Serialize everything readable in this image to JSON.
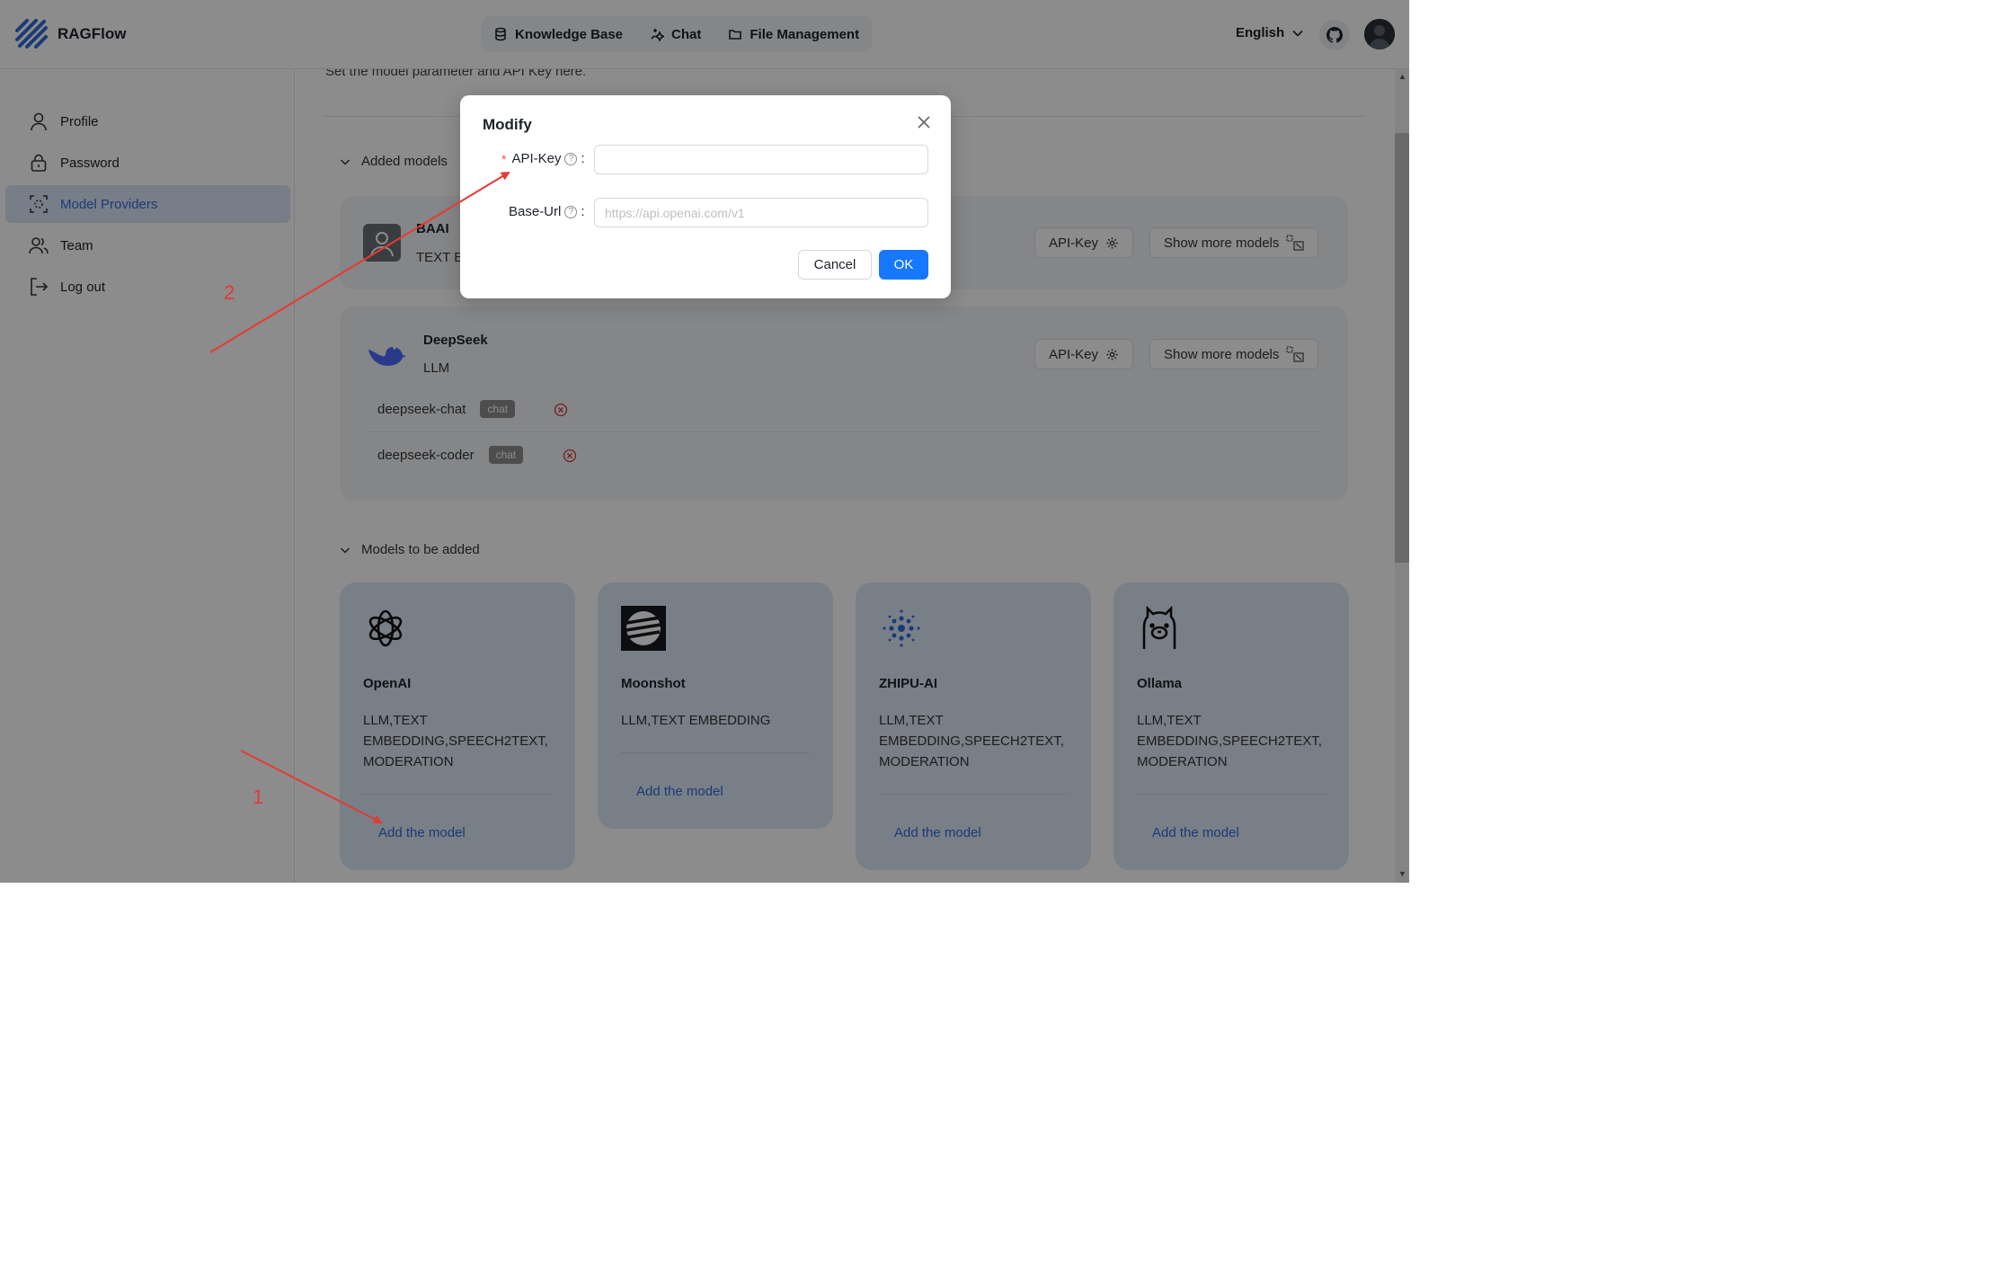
{
  "header": {
    "brand": "RAGFlow",
    "nav": [
      {
        "label": "Knowledge Base",
        "icon": "database-icon"
      },
      {
        "label": "Chat",
        "icon": "chat-sparkle-icon"
      },
      {
        "label": "File Management",
        "icon": "folder-icon"
      }
    ],
    "language": "English"
  },
  "sidebar": {
    "items": [
      {
        "label": "Profile",
        "icon": "user-icon"
      },
      {
        "label": "Password",
        "icon": "lock-icon"
      },
      {
        "label": "Model Providers",
        "icon": "model-providers-icon",
        "active": true
      },
      {
        "label": "Team",
        "icon": "team-icon"
      },
      {
        "label": "Log out",
        "icon": "logout-icon"
      }
    ]
  },
  "main": {
    "subtitle": "Set the model parameter and API Key here.",
    "added_title": "Added models",
    "added": [
      {
        "name": "BAAI",
        "tags": "TEXT EMBEDDING",
        "api_key_label": "API-Key",
        "show_more_label": "Show more models"
      },
      {
        "name": "DeepSeek",
        "tags": "LLM",
        "api_key_label": "API-Key",
        "show_more_label": "Show more models",
        "models": [
          {
            "name": "deepseek-chat",
            "type": "chat"
          },
          {
            "name": "deepseek-coder",
            "type": "chat"
          }
        ]
      }
    ],
    "to_add_title": "Models to be added",
    "to_add": [
      {
        "name": "OpenAI",
        "tags": "LLM,TEXT EMBEDDING,SPEECH2TEXT, MODERATION",
        "link": "Add the model"
      },
      {
        "name": "Moonshot",
        "tags": "LLM,TEXT EMBEDDING",
        "link": "Add the model"
      },
      {
        "name": "ZHIPU-AI",
        "tags": "LLM,TEXT EMBEDDING,SPEECH2TEXT, MODERATION",
        "link": "Add the model"
      },
      {
        "name": "Ollama",
        "tags": "LLM,TEXT EMBEDDING,SPEECH2TEXT, MODERATION",
        "link": "Add the model"
      }
    ]
  },
  "modal": {
    "title": "Modify",
    "api_key_label": "API-Key",
    "api_key_value": "",
    "base_url_label": "Base-Url",
    "base_url_placeholder": "https://api.openai.com/v1",
    "cancel_label": "Cancel",
    "ok_label": "OK",
    "colon": ":"
  },
  "annotations": {
    "step1": "1",
    "step2": "2"
  },
  "colors": {
    "accent": "#1677ff",
    "link": "#2f6bd7",
    "annotation": "#e53935"
  }
}
